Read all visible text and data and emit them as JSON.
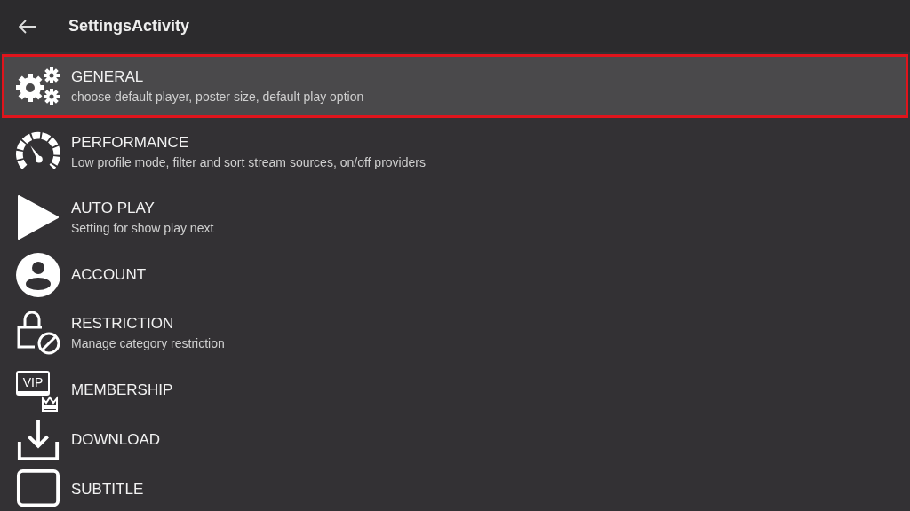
{
  "app_bar": {
    "title": "SettingsActivity"
  },
  "items": [
    {
      "kind": "gears",
      "title": "GENERAL",
      "subtitle": "choose default player, poster size, default play option",
      "selected": true
    },
    {
      "kind": "gauge",
      "title": "PERFORMANCE",
      "subtitle": "Low profile mode, filter and sort stream sources, on/off providers",
      "selected": false
    },
    {
      "kind": "play",
      "title": "AUTO PLAY",
      "subtitle": "Setting for show play next",
      "selected": false
    },
    {
      "kind": "account",
      "title": "ACCOUNT",
      "selected": false
    },
    {
      "kind": "restriction",
      "title": "RESTRICTION",
      "subtitle": "Manage category restriction",
      "selected": false
    },
    {
      "kind": "vip",
      "title": "MEMBERSHIP",
      "icon_text": "VIP",
      "selected": false
    },
    {
      "kind": "download",
      "title": "DOWNLOAD",
      "selected": false
    },
    {
      "kind": "subtitle",
      "title": "SUBTITLE",
      "selected": false
    }
  ]
}
